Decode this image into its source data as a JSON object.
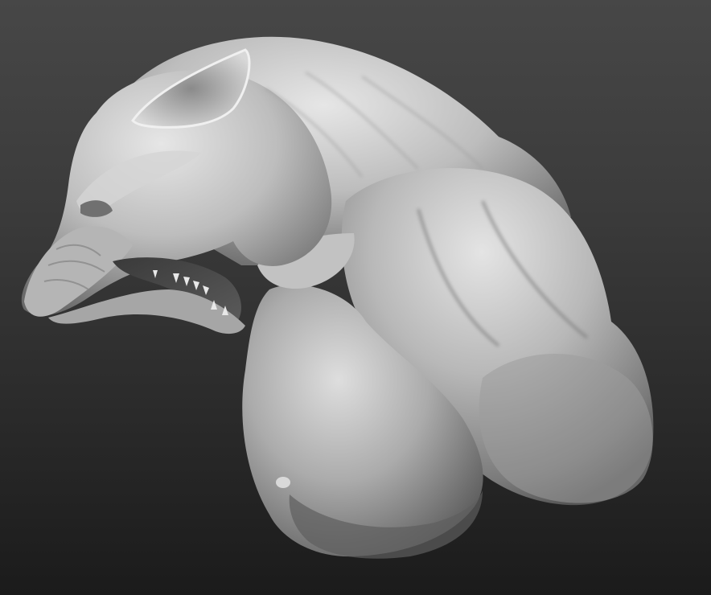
{
  "viewport": {
    "background_top": "#474747",
    "background_bottom": "#1b1b1b",
    "material_light": "#e2e2e2",
    "material_mid": "#a8a8a8",
    "material_dark": "#4a4a4a"
  },
  "model": {
    "subject": "werewolf-bust-sculpt",
    "icon": "sculpt-mesh-icon"
  }
}
